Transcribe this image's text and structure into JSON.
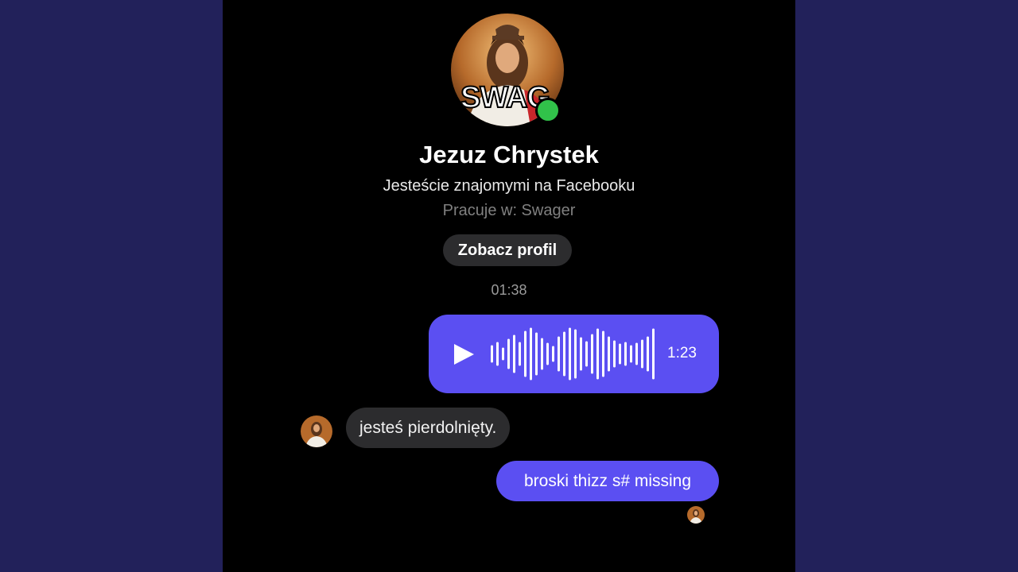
{
  "contact": {
    "name": "Jezuz Chrystek",
    "relation": "Jesteście znajomymi na Facebooku",
    "work": "Pracuje w: Swager",
    "avatar_badge_text": "SWAG",
    "online_status_color": "#31c24a"
  },
  "actions": {
    "view_profile_label": "Zobacz profil"
  },
  "conversation": {
    "timestamp": "01:38",
    "messages": [
      {
        "from": "me",
        "type": "voice",
        "duration": "1:23"
      },
      {
        "from": "contact",
        "type": "text",
        "text": "jesteś pierdolnięty."
      },
      {
        "from": "me",
        "type": "text",
        "text": "broski thizz s# missing"
      }
    ]
  },
  "colors": {
    "outer_background": "#22215a",
    "app_background": "#000000",
    "outgoing_bubble": "#5b4ff2",
    "incoming_bubble": "#2c2c2e"
  }
}
